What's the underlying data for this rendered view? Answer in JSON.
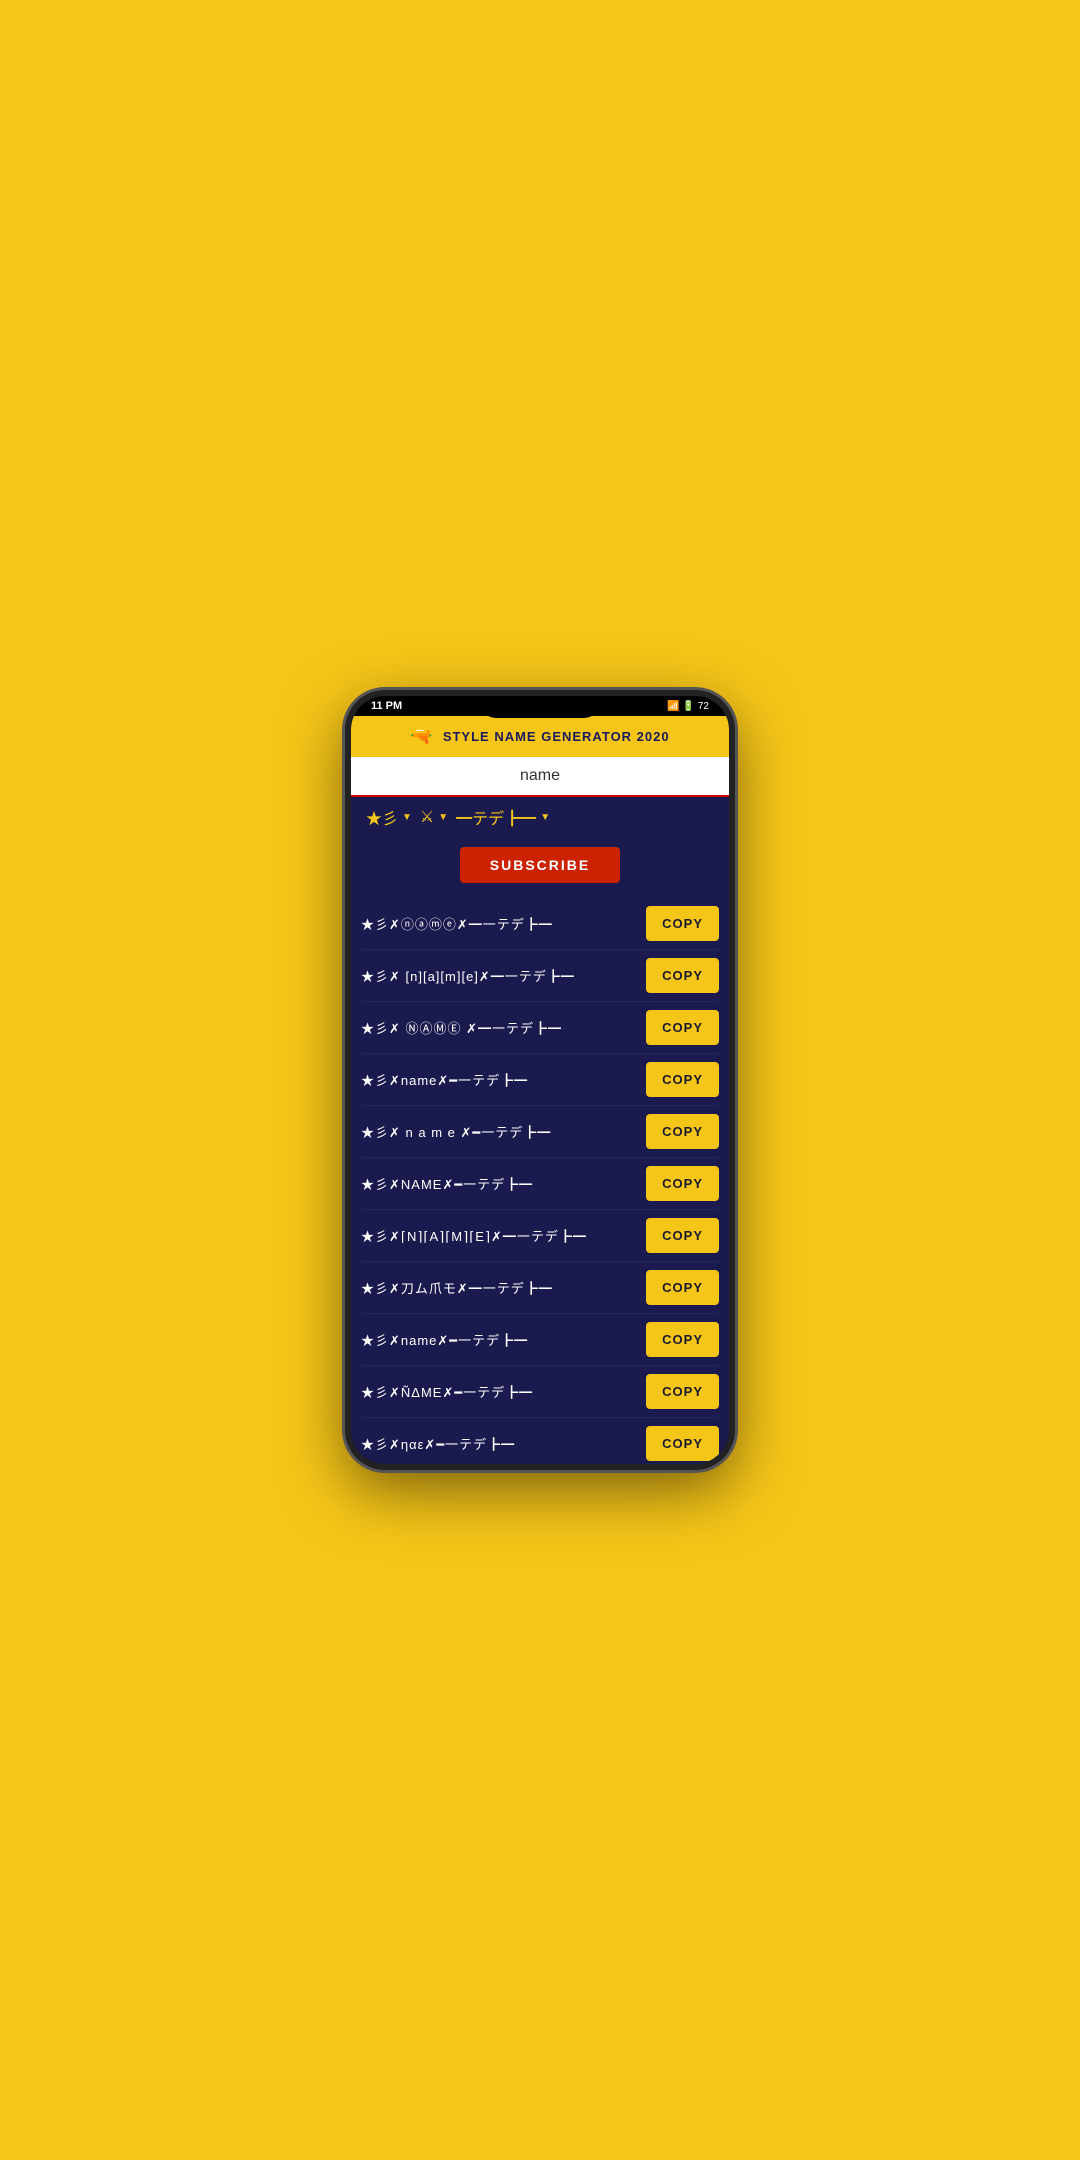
{
  "statusBar": {
    "time": "11 PM",
    "battery": "72",
    "signal": "▌▌▌"
  },
  "header": {
    "title": "STYLE NAME GENERATOR 2020",
    "gunIcon": "🔫"
  },
  "searchInput": {
    "value": "name",
    "placeholder": "name"
  },
  "toolbar": {
    "items": [
      {
        "icon": "★彡",
        "arrow": "▼"
      },
      {
        "icon": "⚔",
        "arrow": "▼"
      },
      {
        "icon": "🔫デ",
        "arrow": "▼"
      }
    ]
  },
  "subscribeButton": "SUBSCRIBE",
  "names": [
    {
      "id": 1,
      "text": "★彡✗ⓝⓐⓜⓔ✗━一テデ┣━"
    },
    {
      "id": 2,
      "text": "★彡✗ [n][a][m][e]✗━一テデ┣━"
    },
    {
      "id": 3,
      "text": "★彡✗ ⓃⒶⓂⒺ ✗━一テデ┣━"
    },
    {
      "id": 4,
      "text": "★彡✗name✗━一テデ┣━"
    },
    {
      "id": 5,
      "text": "★彡✗ n a m e ✗━一テデ┣━"
    },
    {
      "id": 6,
      "text": "★彡✗NAME✗━一テデ┣━"
    },
    {
      "id": 7,
      "text": "★彡✗⌈N⌉⌈A⌉⌈M⌉⌈E⌉✗━一テデ┣━"
    },
    {
      "id": 8,
      "text": "★彡✗刀ム爪モ✗━一テデ┣━"
    },
    {
      "id": 9,
      "text": "★彡✗name✗━一テデ┣━"
    },
    {
      "id": 10,
      "text": "★彡✗ÑΔMΕ✗━一テデ┣━"
    },
    {
      "id": 11,
      "text": "★彡✗ηαε✗━一テデ┣━"
    }
  ],
  "copyButtonLabel": "COPY"
}
